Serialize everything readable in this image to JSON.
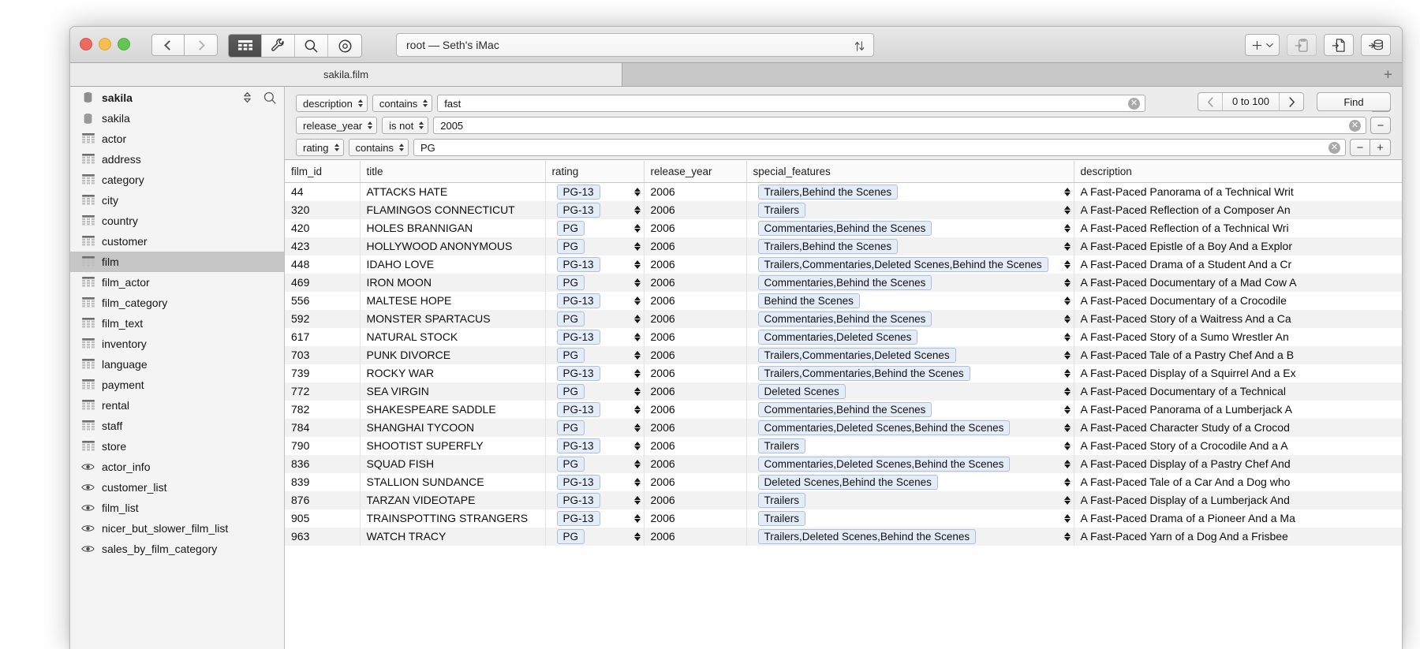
{
  "window": {
    "title": "root — Seth's iMac",
    "traffic_lights": [
      "close",
      "minimize",
      "zoom"
    ]
  },
  "toolbar": {
    "back_label": "back",
    "forward_label": "forward",
    "modes": [
      {
        "name": "structure",
        "active": false,
        "icon": "table-grid-icon"
      },
      {
        "name": "content",
        "active": true,
        "icon": "table-grid-icon"
      },
      {
        "name": "relations",
        "active": false,
        "icon": "wrench-icon"
      },
      {
        "name": "query",
        "active": false,
        "icon": "magnifier-icon"
      },
      {
        "name": "status",
        "active": false,
        "icon": "target-icon"
      }
    ],
    "sort_icon": "sort-arrows-icon",
    "right_buttons": [
      {
        "name": "add",
        "icon": "plus-chevron-icon",
        "disabled": false
      },
      {
        "name": "duplicate",
        "icon": "clipboard-in-icon",
        "disabled": true
      },
      {
        "name": "import-file",
        "icon": "file-in-icon",
        "disabled": false
      },
      {
        "name": "import-database",
        "icon": "database-in-icon",
        "disabled": false
      }
    ]
  },
  "tabs": {
    "items": [
      {
        "label": "sakila.film",
        "active": true
      }
    ],
    "new_tab_label": "+"
  },
  "sidebar": {
    "database": "sakila",
    "sort_icon": "updown-icon",
    "search_icon": "search-icon",
    "items": [
      {
        "label": "sakila",
        "icon": "database-icon",
        "selected": false
      },
      {
        "label": "actor",
        "icon": "table-icon",
        "selected": false
      },
      {
        "label": "address",
        "icon": "table-icon",
        "selected": false
      },
      {
        "label": "category",
        "icon": "table-icon",
        "selected": false
      },
      {
        "label": "city",
        "icon": "table-icon",
        "selected": false
      },
      {
        "label": "country",
        "icon": "table-icon",
        "selected": false
      },
      {
        "label": "customer",
        "icon": "table-icon",
        "selected": false
      },
      {
        "label": "film",
        "icon": "table-icon",
        "selected": true
      },
      {
        "label": "film_actor",
        "icon": "table-icon",
        "selected": false
      },
      {
        "label": "film_category",
        "icon": "table-icon",
        "selected": false
      },
      {
        "label": "film_text",
        "icon": "table-icon",
        "selected": false
      },
      {
        "label": "inventory",
        "icon": "table-icon",
        "selected": false
      },
      {
        "label": "language",
        "icon": "table-icon",
        "selected": false
      },
      {
        "label": "payment",
        "icon": "table-icon",
        "selected": false
      },
      {
        "label": "rental",
        "icon": "table-icon",
        "selected": false
      },
      {
        "label": "staff",
        "icon": "table-icon",
        "selected": false
      },
      {
        "label": "store",
        "icon": "table-icon",
        "selected": false
      },
      {
        "label": "actor_info",
        "icon": "eye-icon",
        "selected": false
      },
      {
        "label": "customer_list",
        "icon": "eye-icon",
        "selected": false
      },
      {
        "label": "film_list",
        "icon": "eye-icon",
        "selected": false
      },
      {
        "label": "nicer_but_slower_film_list",
        "icon": "eye-icon",
        "selected": false
      },
      {
        "label": "sales_by_film_category",
        "icon": "eye-icon",
        "selected": false
      }
    ]
  },
  "filters": {
    "rows": [
      {
        "field": "description",
        "operator": "contains",
        "value": "fast",
        "buttons": [
          "minus"
        ]
      },
      {
        "field": "release_year",
        "operator": "is not",
        "value": "2005",
        "buttons": [
          "minus"
        ]
      },
      {
        "field": "rating",
        "operator": "contains",
        "value": "PG",
        "buttons": [
          "minus",
          "plus"
        ]
      }
    ],
    "pagination": {
      "prev": "‹",
      "range": "0 to 100",
      "next": "›"
    },
    "find_label": "Find",
    "clear_icon": "clear-circle-icon"
  },
  "table": {
    "columns": [
      "film_id",
      "title",
      "rating",
      "release_year",
      "special_features",
      "description"
    ],
    "rows": [
      {
        "film_id": "44",
        "title": "ATTACKS HATE",
        "rating": "PG-13",
        "release_year": "2006",
        "special_features": "Trailers,Behind the Scenes",
        "description": "A Fast-Paced Panorama of a Technical Writ"
      },
      {
        "film_id": "320",
        "title": "FLAMINGOS CONNECTICUT",
        "rating": "PG-13",
        "release_year": "2006",
        "special_features": "Trailers",
        "description": "A Fast-Paced Reflection of a Composer An"
      },
      {
        "film_id": "420",
        "title": "HOLES BRANNIGAN",
        "rating": "PG",
        "release_year": "2006",
        "special_features": "Commentaries,Behind the Scenes",
        "description": "A Fast-Paced Reflection of a Technical Wri"
      },
      {
        "film_id": "423",
        "title": "HOLLYWOOD ANONYMOUS",
        "rating": "PG",
        "release_year": "2006",
        "special_features": "Trailers,Behind the Scenes",
        "description": "A Fast-Paced Epistle of a Boy And a Explor"
      },
      {
        "film_id": "448",
        "title": "IDAHO LOVE",
        "rating": "PG-13",
        "release_year": "2006",
        "special_features": "Trailers,Commentaries,Deleted Scenes,Behind the Scenes",
        "description": "A Fast-Paced Drama of a Student And a Cr"
      },
      {
        "film_id": "469",
        "title": "IRON MOON",
        "rating": "PG",
        "release_year": "2006",
        "special_features": "Commentaries,Behind the Scenes",
        "description": "A Fast-Paced Documentary of a Mad Cow A"
      },
      {
        "film_id": "556",
        "title": "MALTESE HOPE",
        "rating": "PG-13",
        "release_year": "2006",
        "special_features": "Behind the Scenes",
        "description": "A Fast-Paced Documentary of a Crocodile"
      },
      {
        "film_id": "592",
        "title": "MONSTER SPARTACUS",
        "rating": "PG",
        "release_year": "2006",
        "special_features": "Commentaries,Behind the Scenes",
        "description": "A Fast-Paced Story of a Waitress And a Ca"
      },
      {
        "film_id": "617",
        "title": "NATURAL STOCK",
        "rating": "PG-13",
        "release_year": "2006",
        "special_features": "Commentaries,Deleted Scenes",
        "description": "A Fast-Paced Story of a Sumo Wrestler An"
      },
      {
        "film_id": "703",
        "title": "PUNK DIVORCE",
        "rating": "PG",
        "release_year": "2006",
        "special_features": "Trailers,Commentaries,Deleted Scenes",
        "description": "A Fast-Paced Tale of a Pastry Chef And a B"
      },
      {
        "film_id": "739",
        "title": "ROCKY WAR",
        "rating": "PG-13",
        "release_year": "2006",
        "special_features": "Trailers,Commentaries,Behind the Scenes",
        "description": "A Fast-Paced Display of a Squirrel And a Ex"
      },
      {
        "film_id": "772",
        "title": "SEA VIRGIN",
        "rating": "PG",
        "release_year": "2006",
        "special_features": "Deleted Scenes",
        "description": "A Fast-Paced Documentary of a Technical"
      },
      {
        "film_id": "782",
        "title": "SHAKESPEARE SADDLE",
        "rating": "PG-13",
        "release_year": "2006",
        "special_features": "Commentaries,Behind the Scenes",
        "description": "A Fast-Paced Panorama of a Lumberjack A"
      },
      {
        "film_id": "784",
        "title": "SHANGHAI TYCOON",
        "rating": "PG",
        "release_year": "2006",
        "special_features": "Commentaries,Deleted Scenes,Behind the Scenes",
        "description": "A Fast-Paced Character Study of a Crocod"
      },
      {
        "film_id": "790",
        "title": "SHOOTIST SUPERFLY",
        "rating": "PG-13",
        "release_year": "2006",
        "special_features": "Trailers",
        "description": "A Fast-Paced Story of a Crocodile And a A"
      },
      {
        "film_id": "836",
        "title": "SQUAD FISH",
        "rating": "PG",
        "release_year": "2006",
        "special_features": "Commentaries,Deleted Scenes,Behind the Scenes",
        "description": "A Fast-Paced Display of a Pastry Chef And"
      },
      {
        "film_id": "839",
        "title": "STALLION SUNDANCE",
        "rating": "PG-13",
        "release_year": "2006",
        "special_features": "Deleted Scenes,Behind the Scenes",
        "description": "A Fast-Paced Tale of a Car And a Dog who"
      },
      {
        "film_id": "876",
        "title": "TARZAN VIDEOTAPE",
        "rating": "PG-13",
        "release_year": "2006",
        "special_features": "Trailers",
        "description": "A Fast-Paced Display of a Lumberjack And"
      },
      {
        "film_id": "905",
        "title": "TRAINSPOTTING STRANGERS",
        "rating": "PG-13",
        "release_year": "2006",
        "special_features": "Trailers",
        "description": "A Fast-Paced Drama of a Pioneer And a Ma"
      },
      {
        "film_id": "963",
        "title": "WATCH TRACY",
        "rating": "PG",
        "release_year": "2006",
        "special_features": "Trailers,Deleted Scenes,Behind the Scenes",
        "description": "A Fast-Paced Yarn of a Dog And a Frisbee"
      }
    ]
  },
  "colors": {
    "pill_bg": "#e4ecf8",
    "pill_border": "#aebfda",
    "selection": "#c6c6c6",
    "stripe": "#f2f2f2",
    "traffic_red": "#ed6a5e",
    "traffic_yellow": "#f5bf4f",
    "traffic_green": "#62c554"
  }
}
